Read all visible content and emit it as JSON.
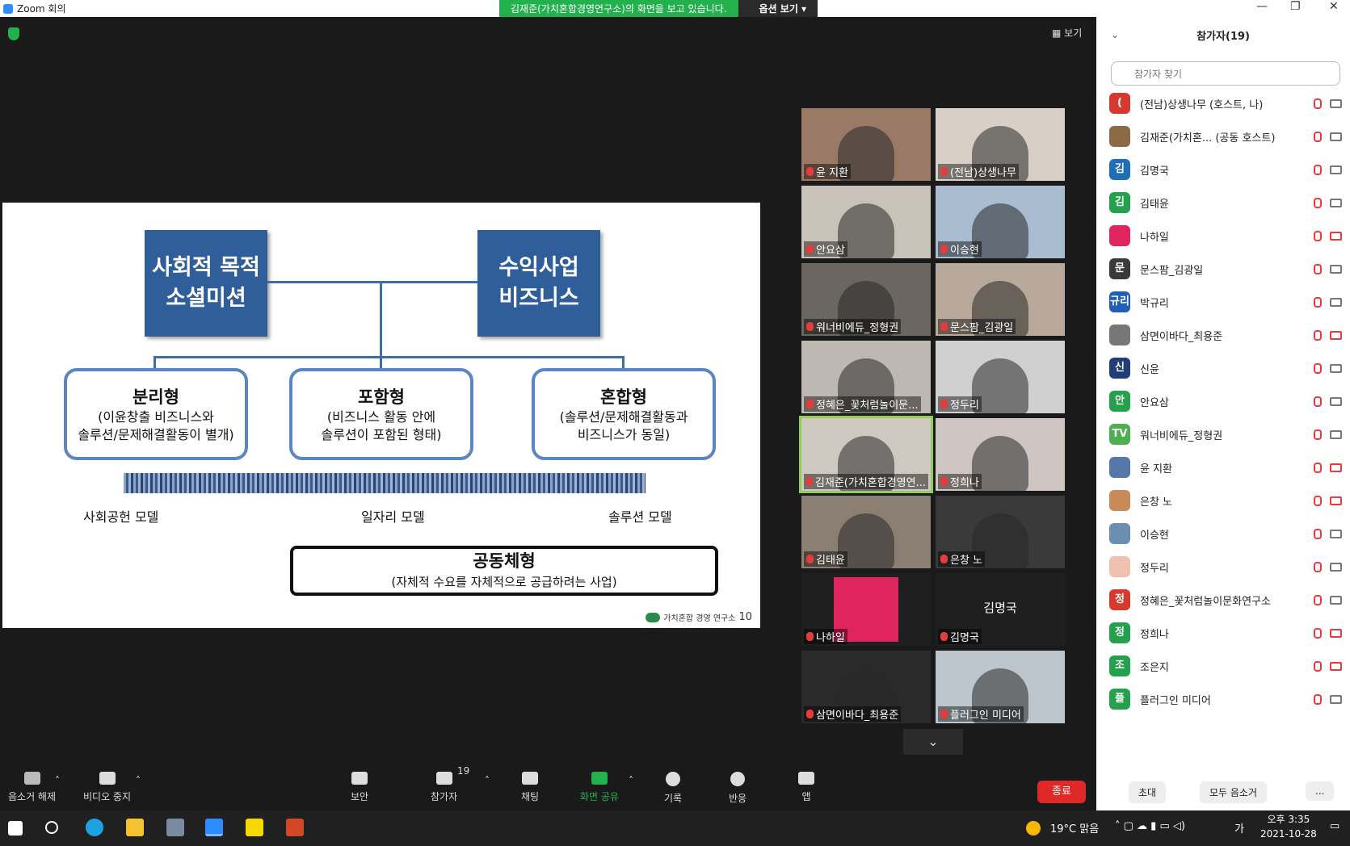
{
  "window": {
    "title": "Zoom 회의"
  },
  "share_banner": {
    "message": "김재준(가치혼합경영연구소)의 화면을 보고 있습니다.",
    "options": "옵션 보기"
  },
  "view_button": "보기",
  "slide": {
    "box_left": [
      "사회적 목적",
      "소셜미션"
    ],
    "box_right": [
      "수익사업",
      "비즈니스"
    ],
    "types": [
      {
        "title": "분리형",
        "desc": [
          "(이윤창출 비즈니스와",
          "솔루션/문제해결활동이 별개)"
        ]
      },
      {
        "title": "포함형",
        "desc": [
          "(비즈니스 활동 안에",
          "솔루션이 포함된 형태)"
        ]
      },
      {
        "title": "혼합형",
        "desc": [
          "(솔루션/문제해결활동과",
          "비즈니스가 동일)"
        ]
      }
    ],
    "models": [
      "사회공헌 모델",
      "일자리 모델",
      "솔루션 모델"
    ],
    "common": {
      "title": "공동체형",
      "desc": "(자체적 수요를 자체적으로 공급하려는 사업)"
    },
    "footer_org": "가치혼합 경영 연구소",
    "page_number": "10"
  },
  "video_tiles": [
    "윤 지환",
    "(전남)상생나무",
    "안요삼",
    "이승현",
    "워너비에듀_정형권",
    "문스팜_김광일",
    "정혜은_꽃처럼놀이문...",
    "정두리",
    "김재준(가치혼합경영연...",
    "정희나",
    "김태윤",
    "은창 노",
    "나하일",
    "김명국",
    "삼면이바다_최용준",
    "플러그인 미디어"
  ],
  "tile_big_name": "김명국",
  "toolbar": {
    "unmute": "음소거 해제",
    "stop_video": "비디오 중지",
    "security": "보안",
    "participants": "참가자",
    "participants_count": "19",
    "chat": "채팅",
    "share": "화면 공유",
    "record": "기록",
    "reactions": "반응",
    "apps": "앱",
    "end": "종료"
  },
  "panel": {
    "title": "참가자(19)",
    "search_placeholder": "참가자 찾기",
    "invite": "초대",
    "mute_all": "모두 음소거",
    "more": "...",
    "participants": [
      {
        "avatar": "(",
        "name": "(전남)상생나무 (호스트, 나)",
        "color": "#d63a2f"
      },
      {
        "avatar": "",
        "name": "김재준(가치혼... (공동 호스트)",
        "color": "#8b6a4a"
      },
      {
        "avatar": "김",
        "name": "김명국",
        "color": "#1f6fb8"
      },
      {
        "avatar": "김",
        "name": "김태윤",
        "color": "#23a14d"
      },
      {
        "avatar": "",
        "name": "나하일",
        "color": "#e0245e"
      },
      {
        "avatar": "문",
        "name": "문스팜_김광일",
        "color": "#3a3a3a"
      },
      {
        "avatar": "규리",
        "name": "박규리",
        "color": "#1f5fb8"
      },
      {
        "avatar": "",
        "name": "삼면이바다_최용준",
        "color": "#777777"
      },
      {
        "avatar": "신",
        "name": "신윤",
        "color": "#1f3e7a"
      },
      {
        "avatar": "안",
        "name": "안요삼",
        "color": "#23a14d"
      },
      {
        "avatar": "TV",
        "name": "워너비에듀_정형권",
        "color": "#4caf50"
      },
      {
        "avatar": "",
        "name": "윤 지환",
        "color": "#5577aa"
      },
      {
        "avatar": "",
        "name": "은창 노",
        "color": "#c98a5a"
      },
      {
        "avatar": "",
        "name": "이승현",
        "color": "#6a8fb0"
      },
      {
        "avatar": "",
        "name": "정두리",
        "color": "#f0c0b0"
      },
      {
        "avatar": "정",
        "name": "정혜은_꽃처럼놀이문화연구소",
        "color": "#d63a2f"
      },
      {
        "avatar": "정",
        "name": "정희나",
        "color": "#23a14d"
      },
      {
        "avatar": "조",
        "name": "조은지",
        "color": "#23a14d"
      },
      {
        "avatar": "플",
        "name": "플러그인 미디어",
        "color": "#23a14d"
      }
    ]
  },
  "taskbar": {
    "weather": "19°C 맑음",
    "time": "오후 3:35",
    "date": "2021-10-28",
    "ime": "가"
  }
}
